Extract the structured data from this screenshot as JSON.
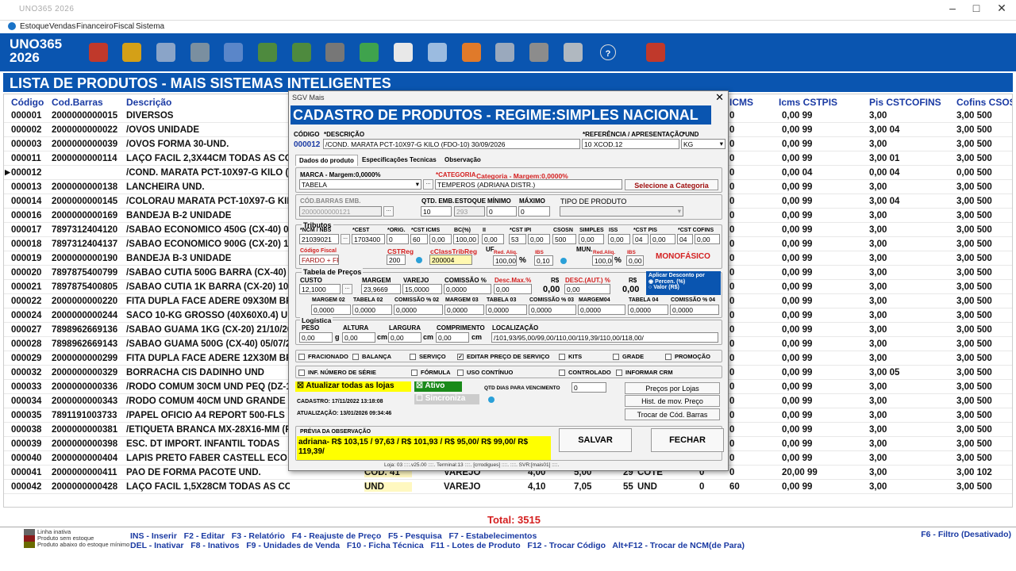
{
  "window": {
    "title": "UNO365 2026"
  },
  "menu": [
    "Estoque",
    "Vendas",
    "Financeiro",
    "Fiscal",
    "Sistema"
  ],
  "brand": {
    "line1": "UNO365",
    "line2": "2026"
  },
  "list": {
    "header": "LISTA DE PRODUTOS - MAIS SISTEMAS INTELIGENTES",
    "columns": {
      "codigo": "Código",
      "codbarras": "Cod.Barras",
      "descricao": "Descrição",
      "icms": "ICMS",
      "icms_cst": "Icms CSTPIS",
      "pis": "Pis CSTCOFINS",
      "cofins": "Cofins CSOSN"
    },
    "rows": [
      {
        "codigo": "000001",
        "barras": "2000000000015",
        "desc": "DIVERSOS",
        "c1": "0",
        "c2": "0,00 99",
        "c3": "3,00",
        "c4": "3,00 500"
      },
      {
        "codigo": "000002",
        "barras": "2000000000022",
        "desc": "/OVOS UNIDADE",
        "c1": "0",
        "c2": "0,00 99",
        "c3": "3,00 04",
        "c4": "3,00 500"
      },
      {
        "codigo": "000003",
        "barras": "2000000000039",
        "desc": "/OVOS FORMA 30-UND.",
        "c1": "0",
        "c2": "0,00 99",
        "c3": "3,00",
        "c4": "3,00 500"
      },
      {
        "codigo": "000011",
        "barras": "2000000000114",
        "desc": "LAÇO FACIL 2,3X44CM TODAS AS CORES",
        "c1": "0",
        "c2": "0,00 99",
        "c3": "3,00 01",
        "c4": "3,00 500"
      },
      {
        "codigo": "000012",
        "barras": "",
        "desc": "/COND. MARATA PCT-10X97-G KILO (FD",
        "c1": "0",
        "c2": "0,00 04",
        "c3": "0,00 04",
        "c4": "0,00 500"
      },
      {
        "codigo": "000013",
        "barras": "2000000000138",
        "desc": "LANCHEIRA UND.",
        "c1": "0",
        "c2": "0,00 99",
        "c3": "3,00",
        "c4": "3,00 500"
      },
      {
        "codigo": "000014",
        "barras": "2000000000145",
        "desc": "/COLORAU MARATA PCT-10X97-G KILO (",
        "c1": "0",
        "c2": "0,00 99",
        "c3": "3,00 04",
        "c4": "3,00 500"
      },
      {
        "codigo": "000016",
        "barras": "2000000000169",
        "desc": "BANDEJA B-2 UNIDADE",
        "c1": "0",
        "c2": "0,00 99",
        "c3": "3,00",
        "c4": "3,00 500"
      },
      {
        "codigo": "000017",
        "barras": "7897312404120",
        "desc": "/SABAO ECONOMICO 450G (CX-40) 02/05",
        "c1": "0",
        "c2": "0,00 99",
        "c3": "3,00",
        "c4": "3,00 500"
      },
      {
        "codigo": "000018",
        "barras": "7897312404137",
        "desc": "/SABAO ECONOMICO 900G (CX-20) 10/09",
        "c1": "0",
        "c2": "0,00 99",
        "c3": "3,00",
        "c4": "3,00 500"
      },
      {
        "codigo": "000019",
        "barras": "2000000000190",
        "desc": "BANDEJA B-3 UNIDADE",
        "c1": "0",
        "c2": "0,00 99",
        "c3": "3,00",
        "c4": "3,00 500"
      },
      {
        "codigo": "000020",
        "barras": "7897875400799",
        "desc": "/SABAO CUTIA 500G BARRA (CX-40) 06/(",
        "c1": "0",
        "c2": "0,00 99",
        "c3": "3,00",
        "c4": "3,00 500"
      },
      {
        "codigo": "000021",
        "barras": "7897875400805",
        "desc": "/SABAO CUTIA 1K BARRA (CX-20) 10/06/",
        "c1": "0",
        "c2": "0,00 99",
        "c3": "3,00",
        "c4": "3,00 500"
      },
      {
        "codigo": "000022",
        "barras": "2000000000220",
        "desc": "FITA DUPLA FACE ADERE 09X30M BRA",
        "c1": "0",
        "c2": "0,00 99",
        "c3": "3,00",
        "c4": "3,00 500"
      },
      {
        "codigo": "000024",
        "barras": "2000000000244",
        "desc": "SACO 10-KG GROSSO (40X60X0.4) UND",
        "c1": "0",
        "c2": "0,00 99",
        "c3": "3,00",
        "c4": "3,00 500"
      },
      {
        "codigo": "000027",
        "barras": "7898962669136",
        "desc": "/SABAO GUAMA 1KG (CX-20) 21/10/2028",
        "c1": "0",
        "c2": "0,00 99",
        "c3": "3,00",
        "c4": "3,00 500"
      },
      {
        "codigo": "000028",
        "barras": "7898962669143",
        "desc": "/SABAO GUAMA 500G (CX-40) 05/07/2028",
        "c1": "0",
        "c2": "0,00 99",
        "c3": "3,00",
        "c4": "3,00 500"
      },
      {
        "codigo": "000029",
        "barras": "2000000000299",
        "desc": "FITA DUPLA FACE ADERE 12X30M BRA",
        "c1": "0",
        "c2": "0,00 99",
        "c3": "3,00",
        "c4": "3,00 500"
      },
      {
        "codigo": "000032",
        "barras": "2000000000329",
        "desc": "BORRACHA CIS DADINHO UND",
        "c1": "0",
        "c2": "0,00 99",
        "c3": "3,00 05",
        "c4": "3,00 500"
      },
      {
        "codigo": "000033",
        "barras": "2000000000336",
        "desc": "/RODO COMUM 30CM UND PEQ (DZ-12)",
        "c1": "0",
        "c2": "0,00 99",
        "c3": "3,00",
        "c4": "3,00 500"
      },
      {
        "codigo": "000034",
        "barras": "2000000000343",
        "desc": "/RODO COMUM 40CM UND GRANDE (DZ",
        "c1": "0",
        "c2": "0,00 99",
        "c3": "3,00",
        "c4": "3,00 500"
      },
      {
        "codigo": "000035",
        "barras": "7891191003733",
        "desc": "/PAPEL OFICIO A4 REPORT 500-FLS",
        "c1": "0",
        "c2": "0,00 99",
        "c3": "3,00",
        "c4": "3,00 500"
      },
      {
        "codigo": "000038",
        "barras": "2000000000381",
        "desc": "/ETIQUETA BRANCA MX-28X16-MM (PCT",
        "c1": "0",
        "c2": "0,00 99",
        "c3": "3,00",
        "c4": "3,00 500"
      },
      {
        "codigo": "000039",
        "barras": "2000000000398",
        "desc": "ESC. DT IMPORT. INFANTIL TODAS",
        "c1": "0",
        "c2": "0,00 99",
        "c3": "3,00",
        "c4": "3,00 500"
      },
      {
        "codigo": "000040",
        "barras": "2000000000404",
        "desc": "LAPIS PRETO FABER CASTELL ECO GR",
        "c1": "0",
        "c2": "0,00 99",
        "c3": "3,00",
        "c4": "3,00 500"
      },
      {
        "codigo": "000041",
        "barras": "2000000000411",
        "desc": "PAO DE FORMA PACOTE UND.",
        "c1": "0",
        "c2": "20,00 99",
        "c3": "3,00",
        "c4": "3,00 102"
      },
      {
        "codigo": "000042",
        "barras": "2000000000428",
        "desc": "LAÇO FACIL 1,5X28CM TODAS AS CORES UND",
        "c1": "60",
        "c2": "0,00 99",
        "c3": "3,00",
        "c4": "3,00 500"
      }
    ],
    "extra41": {
      "cod": "COD. 41",
      "vendatipo": "VAREJO",
      "v1": "4,00",
      "v2": "5,00",
      "qtd": "29",
      "und": "COTE",
      "z": "0"
    },
    "extra42": {
      "cod": "UND",
      "vendatipo": "VAREJO",
      "v1": "4,10",
      "v2": "7,05",
      "qtd": "55",
      "und": "UND",
      "z": "0"
    },
    "total": "Total: 3515"
  },
  "legend": [
    "Linha inativa",
    "Produto sem estoque",
    "Produto abaixo do estoque mínimo"
  ],
  "legend_colors": [
    "#666666",
    "#8b1a1a",
    "#6b6b00"
  ],
  "shortcuts": {
    "line1": "INS - Inserir   F2 - Editar   F3 - Relatório   F4 - Reajuste de Preço   F5 - Pesquisa   F7 - Estabelecimentos",
    "line2": "DEL - Inativar   F8 - Inativos   F9 - Unidades de Venda   F10 - Ficha Técnica   F11 - Lotes de Produto   F12 - Trocar Código   Alt+F12 - Trocar de NCM(de Para)",
    "filter": "F6 - Filtro (Desativado)"
  },
  "dialog": {
    "title": "SGV Mais",
    "header": "CADASTRO  DE  PRODUTOS - REGIME:SIMPLES NACIONAL",
    "codigo_lbl": "CÓDIGO",
    "codigo": "000012",
    "descricao_lbl": "*DESCRIÇÃO",
    "descricao": "/COND. MARATA PCT-10X97-G KILO (FDO-10) 30/09/2026",
    "ref_lbl": "*REFERÊNCIA / APRESENTAÇÃO",
    "ref": "10 XCOD.12",
    "und_lbl": "*UND",
    "und": "KG",
    "tabs": [
      "Dados do produto",
      "Especificações Tecnicas",
      "Observação"
    ],
    "marca_lbl": "MARCA - Margem:0,0000%",
    "marca": "TABELA",
    "categoria_lbl": "*CATEGORIA",
    "categoria_margem": "Categoria - Margem:0,0000%",
    "categoria": "TEMPEROS (ADRIANA DISTR.)",
    "sel_categoria": "Selecione a Categoria",
    "codbarras_emb_lbl": "CÓD.BARRAS EMB.",
    "codbarras_emb": "2000000000121",
    "qtd_emb_lbl": "QTD. EMB.",
    "qtd_emb": "10",
    "estoque_lbl": "ESTOQUE",
    "estoque": "293",
    "minimo_lbl": "MÍNIMO",
    "minimo": "0",
    "maximo_lbl": "MÁXIMO",
    "maximo": "0",
    "tipo_lbl": "TIPO DE PRODUTO",
    "tributos_lbl": "Tributos",
    "trib_labels": [
      "*NCM / NBS",
      "*CEST",
      "*ORIG.",
      "*CST ICMS",
      "BC(%)",
      "II",
      "*CST IPI",
      "CSOSN",
      "SIMPLES",
      "ISS",
      "*CST PIS",
      "*CST COFINS"
    ],
    "ncm": "21039021",
    "cest": "1703400",
    "orig": "0",
    "cst_icms": "60",
    "icms": "0,00",
    "bc": "100,00",
    "ii": "0,00",
    "cst_ipi": "53",
    "ipi": "0,00",
    "csosn": "500",
    "simples": "0,00",
    "iss": "0,00",
    "cst_pis": "04",
    "pis": "0,00",
    "cst_cofins": "04",
    "cofins": "0,00",
    "icms_lbl": "ICMS",
    "ipi_lbl": "IPI",
    "pis_lbl": "PIS",
    "cofins_lbl": "COFINS",
    "cod_fiscal_lbl": "Código Fiscal",
    "cod_fiscal": "FARDO + FRI",
    "cstreg_lbl": "CSTReg",
    "cstreg": "200",
    "cclass_lbl": "cClassTribReg",
    "cclass": "200004",
    "uf_lbl": "UF",
    "red_aliq_lbl": "Red. Aliq.",
    "red_aliq": "100,00",
    "ibs_lbl": "IBS",
    "ibs": "0,10",
    "mun_lbl": "MUN.",
    "red_aliq2_lbl": "Red.Aliq.",
    "red_aliq2": "100,00",
    "ibs2_lbl": "IBS",
    "ibs2": "0,00",
    "pct": "%",
    "monofasico": "MONOFÁSICO",
    "tabela_precos_lbl": "Tabela de Preços",
    "custo_lbl": "CUSTO",
    "custo": "12,1000",
    "margem_lbl": "MARGEM",
    "margem": "23,9669",
    "varejo_lbl": "VAREJO",
    "varejo": "15,0000",
    "comissao_lbl": "COMISSÃO %",
    "comissao": "0,0000",
    "descmax_lbl": "Desc.Max.%",
    "descmax": "0,00",
    "rs_lbl": "R$",
    "rs_val": "0,00",
    "descaut_lbl": "DESC.(AUT.) %",
    "descaut": "0,00",
    "rs2_lbl": "R$",
    "rs2_val": "0,00",
    "aplicar_lbl": "Aplicar Desconto por",
    "aplicar_opts": [
      "Percen. (%)",
      "Valor (R$)"
    ],
    "m2_labels": [
      "MARGEM 02",
      "TABELA 02",
      "COMISSÃO % 02",
      "MARGEM 03",
      "TABELA 03",
      "COMISSÃO % 03",
      "MARGEM04",
      "TABELA 04",
      "COMISSÃO % 04"
    ],
    "m2_values": [
      "0,0000",
      "0,0000",
      "0,0000",
      "0,0000",
      "0,0000",
      "0,0000",
      "0,0000",
      "0,0000",
      "0,0000"
    ],
    "logistica_lbl": "Logística",
    "peso_lbl": "PESO",
    "peso": "0,00",
    "peso_unit": "g",
    "altura_lbl": "ALTURA",
    "altura": "0,00",
    "largura_lbl": "LARGURA",
    "largura": "0,00",
    "comprimento_lbl": "COMPRIMENTO",
    "comprimento": "0,00",
    "cm": "cm",
    "localizacao_lbl": "LOCALIZAÇÃO",
    "localizacao": "/101,93/95,00/99,00/110,00/119,39/110,00/118,00/",
    "checks1": [
      "FRACIONADO",
      "BALANÇA",
      "SERVIÇO",
      "EDITAR PREÇO DE SERVIÇO",
      "KITS",
      "GRADE",
      "PROMOÇÃO"
    ],
    "checks2": [
      "INF. NÚMERO DE SÉRIE",
      "FÓRMULA",
      "USO CONTÍNUO",
      "CONTROLADO",
      "INFORMAR CRM"
    ],
    "atualizar": "Atualizar todas as lojas",
    "ativo": "Ativo",
    "sincroniza": "Sincroniza",
    "qtd_dias_lbl": "QTD DIAS PARA VENCIMENTO",
    "qtd_dias": "0",
    "btn_precos": "Preços por Lojas",
    "btn_hist": "Hist. de mov. Preço",
    "btn_troca": "Trocar de Cód. Barras",
    "cadastro": "CADASTRO: 17/11/2022 13:18:08",
    "atualizacao": "ATUALIZAÇÃO: 13/01/2026 09:34:46",
    "previa_lbl": "PRÉVIA DA OBSERVAÇÃO",
    "previa": "adriana- R$ 103,15 / 97,63 / R$ 101,93 / R$ 95,00/  R$ 99,00/ R$ 119,39/",
    "salvar": "SALVAR",
    "fechar": "FECHAR",
    "status": "Loja: 03 ::::.v25.00 ::::. Terminal:13 ::::. [crrodigues] ::::. ::::. SVR:[mais01] ::::."
  },
  "colors": {
    "blue": "#0a55b0",
    "yellow": "#ffff00",
    "green": "#1a8a1a",
    "red": "#d42020",
    "header_text": "#1a3aa3"
  }
}
